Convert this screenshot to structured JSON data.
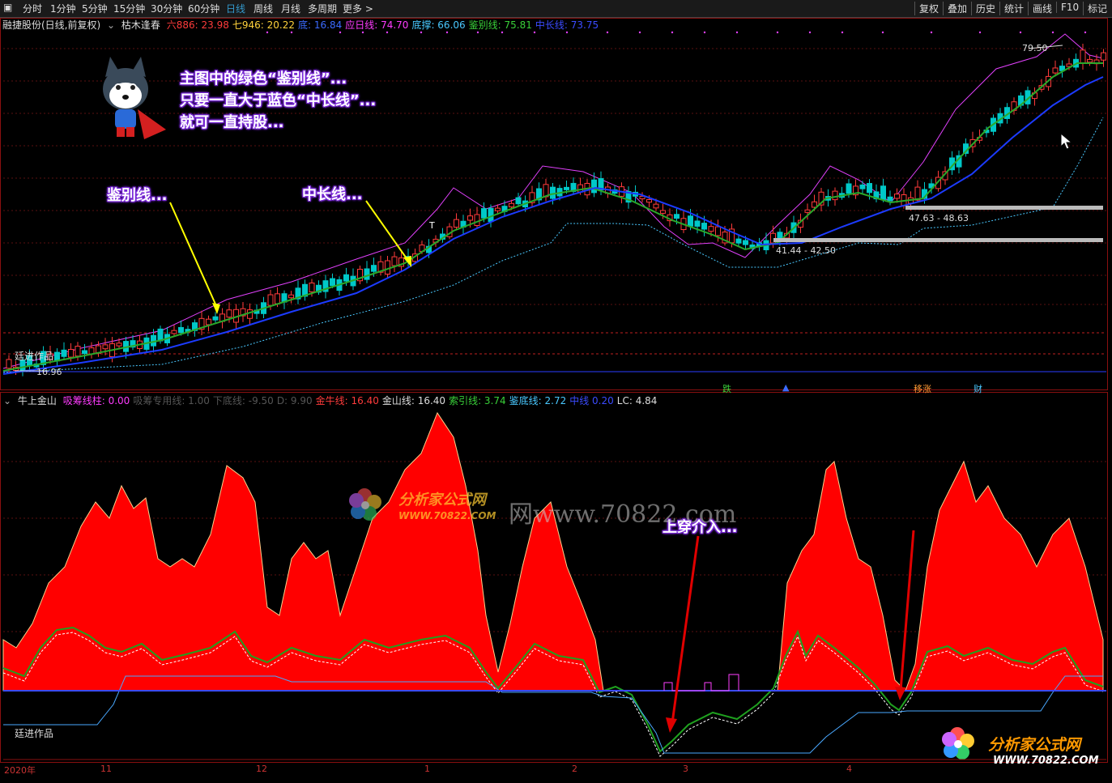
{
  "toolbar": {
    "periods": [
      "分时",
      "1分钟",
      "5分钟",
      "15分钟",
      "30分钟",
      "60分钟",
      "日线",
      "周线",
      "月线",
      "多周期",
      "更多 >"
    ],
    "active_period": "日线",
    "right_buttons": [
      "复权",
      "叠加",
      "历史",
      "统计",
      "画线",
      "F10",
      "标记"
    ]
  },
  "main_info": {
    "stock": "融捷股份(日线,前复权)",
    "formula": "枯木逢春",
    "items": [
      {
        "label": "六886:",
        "value": "23.98",
        "color": "#ff3b3b"
      },
      {
        "label": "七946:",
        "value": "20.22",
        "color": "#ffd23b"
      },
      {
        "label": "底:",
        "value": "16.84",
        "color": "#3b6bff"
      },
      {
        "label": "应日线:",
        "value": "74.70",
        "color": "#ff3bff"
      },
      {
        "label": "底撑:",
        "value": "66.06",
        "color": "#49c8ff"
      },
      {
        "label": "鉴别线:",
        "value": "75.81",
        "color": "#39d039"
      },
      {
        "label": "中长线:",
        "value": "73.75",
        "color": "#3b4bff"
      }
    ]
  },
  "main_chart": {
    "price_high_label": "79.50",
    "price_low_label": "16.96",
    "range1": "47.63 - 48.63",
    "range2": "41.44 - 42.50",
    "signal_t": "T",
    "author_tag": "廷进作品",
    "markers": [
      {
        "text": "跌",
        "color": "#39d039"
      },
      {
        "text": "▲",
        "color": "#3b6bff"
      },
      {
        "text": "移涨",
        "color": "#ff9933"
      },
      {
        "text": "财",
        "color": "#49c8ff"
      }
    ]
  },
  "callouts": {
    "main_text": [
      "主图中的绿色“鉴别线”...",
      "只要一直大于蓝色“中长线”...",
      "就可一直持股..."
    ],
    "label1": "鉴别线...",
    "label2": "中长线...",
    "label3": "上穿介入..."
  },
  "indicator_info": {
    "name": "牛上金山",
    "items": [
      {
        "label": "吸筹线柱:",
        "value": "0.00",
        "color": "#ff3bff"
      },
      {
        "label": "吸筹专用线:",
        "value": "1.00",
        "color": "#555555"
      },
      {
        "label": "下底线:",
        "value": "-9.50",
        "color": "#555555"
      },
      {
        "label": "D:",
        "value": "9.90",
        "color": "#555555"
      },
      {
        "label": "金牛线:",
        "value": "16.40",
        "color": "#ff3b3b"
      },
      {
        "label": "金山线:",
        "value": "16.40",
        "color": "#dddddd"
      },
      {
        "label": "索引线:",
        "value": "3.74",
        "color": "#39d039"
      },
      {
        "label": "鉴底线:",
        "value": "2.72",
        "color": "#49c8ff"
      },
      {
        "label": "中线",
        "value": "0.20",
        "color": "#3b4bff"
      },
      {
        "label": "LC:",
        "value": "4.84",
        "color": "#dddddd"
      }
    ],
    "author_tag": "廷进作品"
  },
  "dates": [
    "2020年",
    "11",
    "12",
    "1",
    "2",
    "3",
    "4"
  ],
  "watermark": {
    "url_text": "网www.70822.com",
    "logo_main": "分析家公式网",
    "logo_sub": "WWW.70822.COM"
  },
  "colors": {
    "up": "#ff3b3b",
    "down": "#00c8c8",
    "identify_line": "#2aa82a",
    "long_line": "#1c3bff",
    "upper_line": "#e040fb",
    "support": "#49c8ff",
    "area": "#ff0000"
  },
  "icons": [
    "dog-mascot-icon",
    "flower-logo-icon",
    "mouse-cursor-icon",
    "chevron-icon"
  ]
}
